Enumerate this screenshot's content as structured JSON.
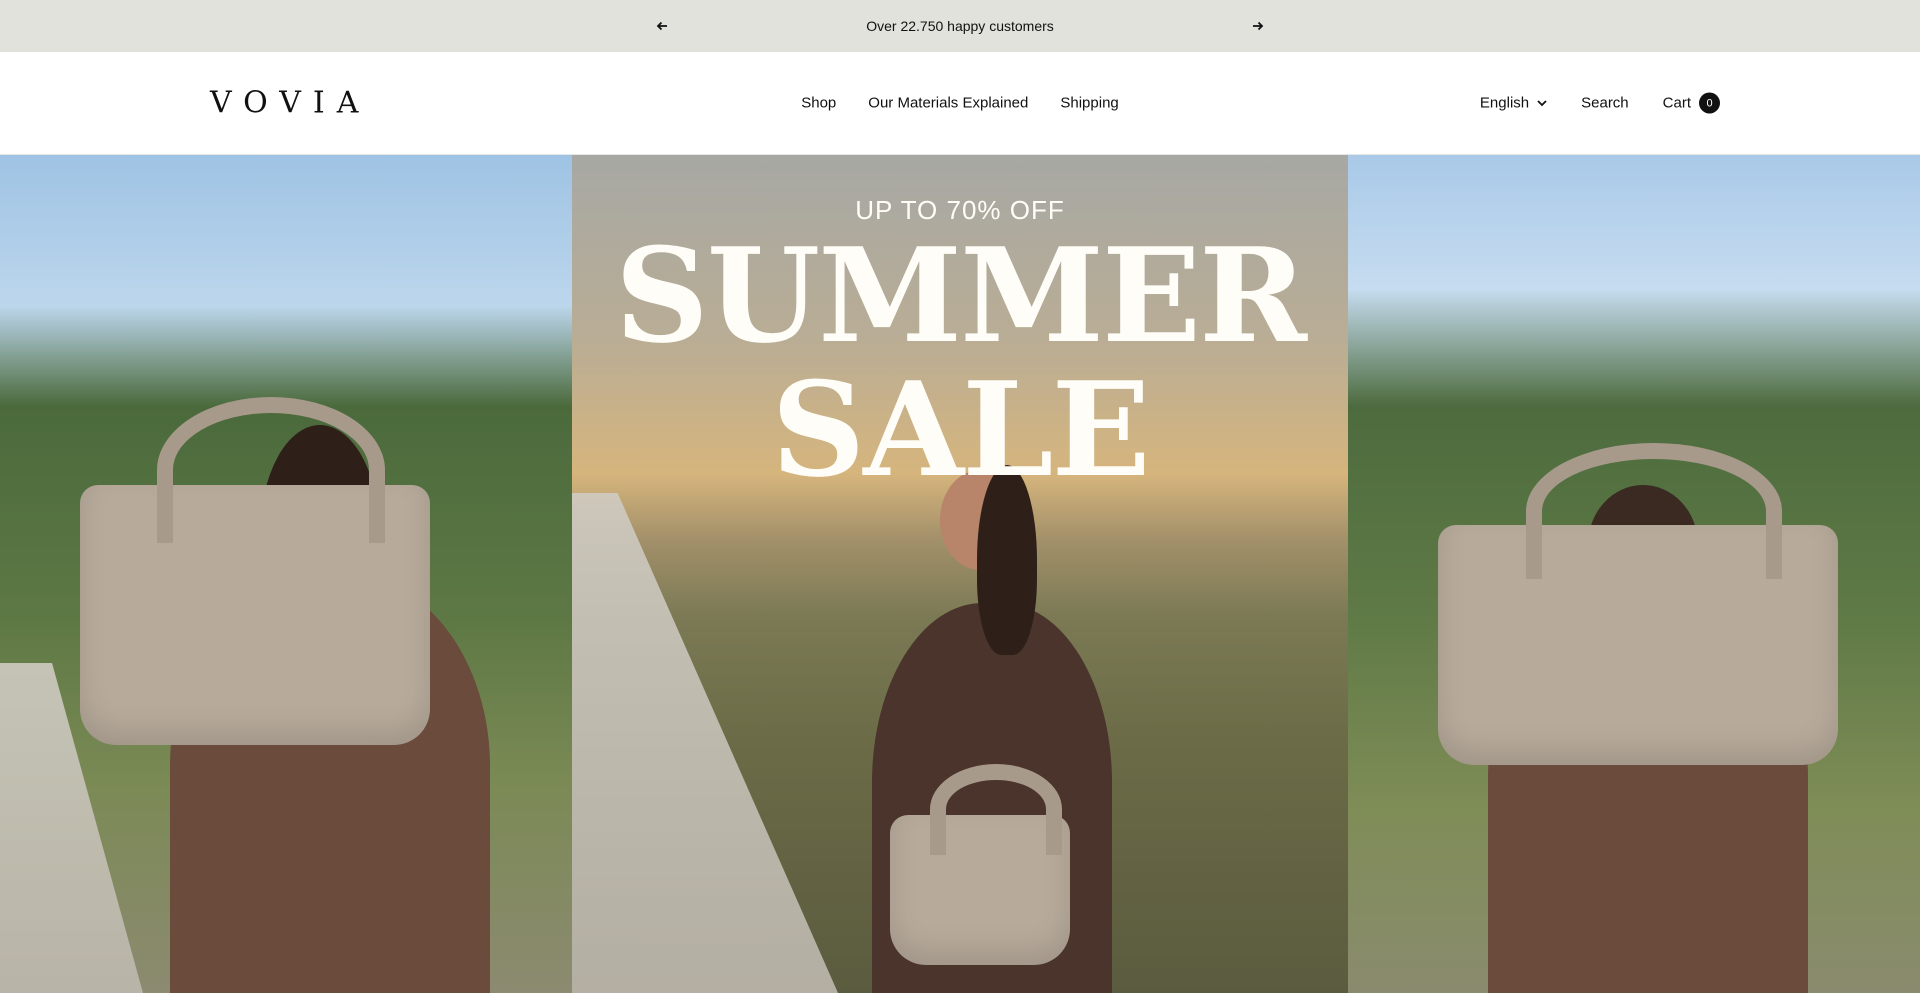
{
  "announcement": {
    "prev_icon": "arrow-left-icon",
    "next_icon": "arrow-right-icon",
    "text": "Over 22.750 happy customers"
  },
  "header": {
    "logo": "VOVIA",
    "nav": [
      "Shop",
      "Our Materials Explained",
      "Shipping"
    ],
    "language": "English",
    "search": "Search",
    "cart": "Cart",
    "cart_count": "0"
  },
  "hero": {
    "subtitle": "UP TO 70% OFF",
    "title_line1": "SUMMER",
    "title_line2": "SALE"
  },
  "colors": {
    "announcement_bg": "#e2e2dc",
    "text": "#111111",
    "hero_text": "#fffdf7"
  }
}
